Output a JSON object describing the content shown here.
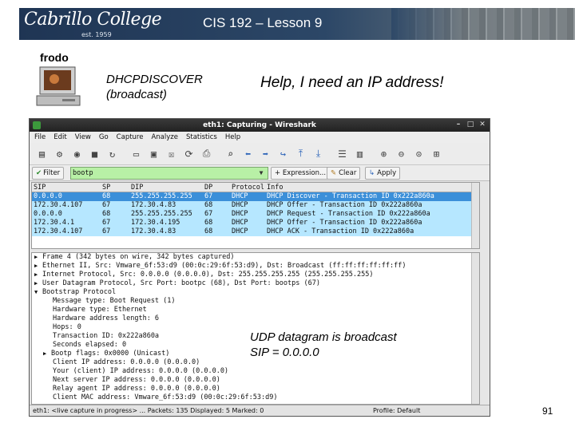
{
  "header": {
    "logo_text": "Cabrillo College",
    "logo_est": "est. 1959",
    "title": "CIS 192 – Lesson 9"
  },
  "host": {
    "label": "frodo",
    "icon": "desktop-computer-icon"
  },
  "dhcp_message": {
    "line1": "DHCPDISCOVER",
    "line2": "(broadcast)"
  },
  "speech": "Help, I need an IP address!",
  "wireshark": {
    "title": "eth1: Capturing - Wireshark",
    "menu": [
      "File",
      "Edit",
      "View",
      "Go",
      "Capture",
      "Analyze",
      "Statistics",
      "Help"
    ],
    "filter": {
      "label": "Filter",
      "value": "bootp",
      "expression_label": "+ Expression...",
      "clear_label": "Clear",
      "apply_label": "Apply"
    },
    "columns": [
      "SIP",
      "SP",
      "DIP",
      "DP",
      "Protocol",
      "Info"
    ],
    "packets": [
      {
        "sip": "0.0.0.0",
        "sp": "68",
        "dip": "255.255.255.255",
        "dp": "67",
        "proto": "DHCP",
        "info": "DHCP Discover - Transaction ID 0x222a860a"
      },
      {
        "sip": "172.30.4.107",
        "sp": "67",
        "dip": "172.30.4.83",
        "dp": "68",
        "proto": "DHCP",
        "info": "DHCP Offer    - Transaction ID 0x222a860a"
      },
      {
        "sip": "0.0.0.0",
        "sp": "68",
        "dip": "255.255.255.255",
        "dp": "67",
        "proto": "DHCP",
        "info": "DHCP Request  - Transaction ID 0x222a860a"
      },
      {
        "sip": "172.30.4.1",
        "sp": "67",
        "dip": "172.30.4.195",
        "dp": "68",
        "proto": "DHCP",
        "info": "DHCP Offer    - Transaction ID 0x222a860a"
      },
      {
        "sip": "172.30.4.107",
        "sp": "67",
        "dip": "172.30.4.83",
        "dp": "68",
        "proto": "DHCP",
        "info": "DHCP ACK      - Transaction ID 0x222a860a"
      }
    ],
    "details": [
      {
        "level": 0,
        "expander": "▶",
        "text": "Frame 4 (342 bytes on wire, 342 bytes captured)"
      },
      {
        "level": 0,
        "expander": "▶",
        "text": "Ethernet II, Src: Vmware_6f:53:d9 (00:0c:29:6f:53:d9), Dst: Broadcast (ff:ff:ff:ff:ff:ff)"
      },
      {
        "level": 0,
        "expander": "▶",
        "text": "Internet Protocol, Src: 0.0.0.0 (0.0.0.0), Dst: 255.255.255.255 (255.255.255.255)"
      },
      {
        "level": 0,
        "expander": "▶",
        "text": "User Datagram Protocol, Src Port: bootpc (68), Dst Port: bootps (67)"
      },
      {
        "level": 0,
        "expander": "▼",
        "text": "Bootstrap Protocol"
      },
      {
        "level": 1,
        "expander": "",
        "text": "Message type: Boot Request (1)"
      },
      {
        "level": 1,
        "expander": "",
        "text": "Hardware type: Ethernet"
      },
      {
        "level": 1,
        "expander": "",
        "text": "Hardware address length: 6"
      },
      {
        "level": 1,
        "expander": "",
        "text": "Hops: 0"
      },
      {
        "level": 1,
        "expander": "",
        "text": "Transaction ID: 0x222a860a"
      },
      {
        "level": 1,
        "expander": "",
        "text": "Seconds elapsed: 0"
      },
      {
        "level": 2,
        "expander": "▶",
        "text": "Bootp flags: 0x0000 (Unicast)"
      },
      {
        "level": 1,
        "expander": "",
        "text": "Client IP address: 0.0.0.0 (0.0.0.0)"
      },
      {
        "level": 1,
        "expander": "",
        "text": "Your (client) IP address: 0.0.0.0 (0.0.0.0)"
      },
      {
        "level": 1,
        "expander": "",
        "text": "Next server IP address: 0.0.0.0 (0.0.0.0)"
      },
      {
        "level": 1,
        "expander": "",
        "text": "Relay agent IP address: 0.0.0.0 (0.0.0.0)"
      },
      {
        "level": 1,
        "expander": "",
        "text": "Client MAC address: Vmware_6f:53:d9 (00:0c:29:6f:53:d9)"
      }
    ],
    "status_left": "eth1: <live capture in progress> ...  Packets: 135 Displayed: 5 Marked: 0",
    "status_right": "Profile: Default"
  },
  "note": {
    "line1": "UDP datagram is broadcast",
    "line2": "SIP = 0.0.0.0"
  },
  "page_number": "91",
  "colors": {
    "packet_row": "#b6e7ff",
    "selected_row": "#3b8fd9",
    "filter_bg": "#b8f0a6",
    "header_bg": "#1f3554"
  }
}
